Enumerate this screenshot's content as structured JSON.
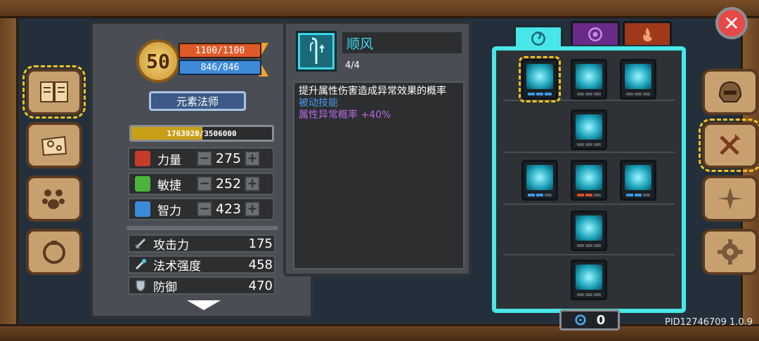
{
  "character": {
    "level": "50",
    "hp": "1100/1100",
    "mp": "846/846",
    "class_name": "元素法师",
    "exp_text": "1763920/3506000",
    "exp_fraction": 0.503
  },
  "attributes": [
    {
      "name": "力量",
      "value": "275",
      "icon": "strength-fist-icon",
      "color": "#c83a2a"
    },
    {
      "name": "敏捷",
      "value": "252",
      "icon": "agility-feather-icon",
      "color": "#4ab43a"
    },
    {
      "name": "智力",
      "value": "423",
      "icon": "intelligence-book-icon",
      "color": "#3a8ad8"
    }
  ],
  "attribute_controls": {
    "minus": "−",
    "plus": "+"
  },
  "stats": [
    {
      "name": "攻击力",
      "value": "175",
      "icon": "sword-icon"
    },
    {
      "name": "法术强度",
      "value": "458",
      "icon": "magic-wand-icon"
    },
    {
      "name": "防御",
      "value": "470",
      "icon": "shield-icon"
    }
  ],
  "skill_detail": {
    "name": "顺风",
    "level": "4/4",
    "description": "提升属性伤害造成异常效果的概率",
    "type": "被动技能",
    "effect": "属性异常概率 +40%"
  },
  "skill_points": "0",
  "close_label": "✕",
  "version": "PID12746709 1.0.9",
  "colors": {
    "accent_cyan": "#49e6e8",
    "gold": "#f2c21a",
    "hp": "#e05a28",
    "mp": "#3f8ad8"
  }
}
